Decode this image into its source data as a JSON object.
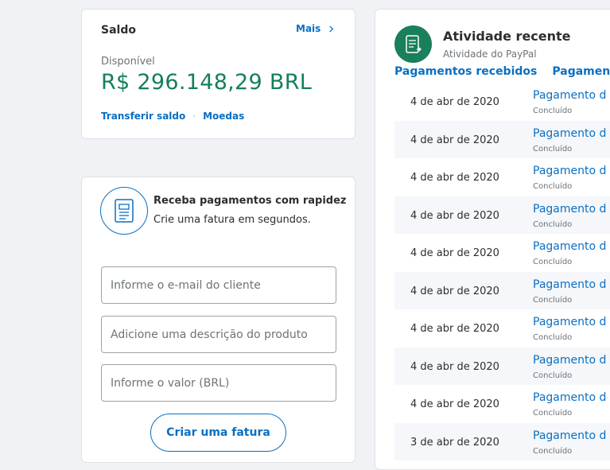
{
  "colors": {
    "accent": "#0a6fc2",
    "balance_green": "#14805a",
    "activity_icon_bg": "#1a7f5b"
  },
  "balance_card": {
    "title": "Saldo",
    "more_label": "Mais",
    "available_label": "Disponível",
    "amount": "R$ 296.148,29 BRL",
    "transfer_link": "Transferir saldo",
    "separator": "·",
    "currencies_link": "Moedas"
  },
  "invoice_card": {
    "title": "Receba pagamentos com rapidez",
    "subtitle": "Crie uma fatura em segundos.",
    "icon": "invoice-icon",
    "email_placeholder": "Informe o e-mail do cliente",
    "description_placeholder": "Adicione uma descrição do produto",
    "amount_placeholder": "Informe o valor (BRL)",
    "create_button": "Criar uma fatura"
  },
  "activity_card": {
    "title": "Atividade recente",
    "subtitle": "Atividade do PayPal",
    "icon": "activity-list-icon",
    "tabs": [
      "Pagamentos recebidos",
      "Pagamentos"
    ],
    "rows": [
      {
        "date": "4 de abr de 2020",
        "description": "Pagamento d",
        "status": "Concluído"
      },
      {
        "date": "4 de abr de 2020",
        "description": "Pagamento d",
        "status": "Concluído"
      },
      {
        "date": "4 de abr de 2020",
        "description": "Pagamento d",
        "status": "Concluído"
      },
      {
        "date": "4 de abr de 2020",
        "description": "Pagamento d",
        "status": "Concluído"
      },
      {
        "date": "4 de abr de 2020",
        "description": "Pagamento d",
        "status": "Concluído"
      },
      {
        "date": "4 de abr de 2020",
        "description": "Pagamento d",
        "status": "Concluído"
      },
      {
        "date": "4 de abr de 2020",
        "description": "Pagamento d",
        "status": "Concluído"
      },
      {
        "date": "4 de abr de 2020",
        "description": "Pagamento d",
        "status": "Concluído"
      },
      {
        "date": "4 de abr de 2020",
        "description": "Pagamento d",
        "status": "Concluído"
      },
      {
        "date": "3 de abr de 2020",
        "description": "Pagamento d",
        "status": "Concluído"
      }
    ]
  }
}
